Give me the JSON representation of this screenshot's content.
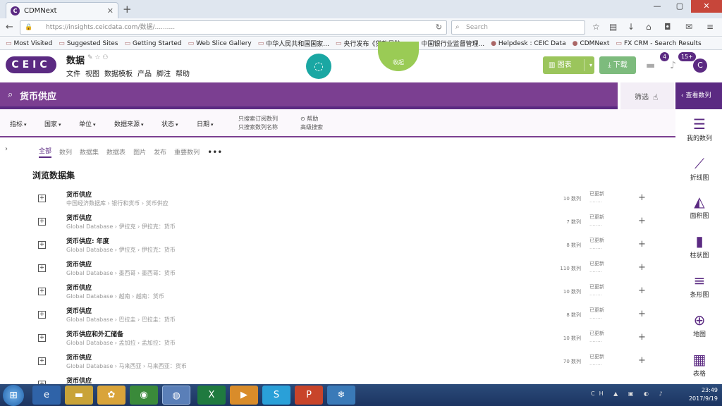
{
  "browser": {
    "tab_title": "CDMNext",
    "tab_close": "✕",
    "new_tab": "+",
    "url": "https://insights.ceicdata.com/数据/..........",
    "search_placeholder": "Search",
    "window_min": "—",
    "window_max": "▢",
    "window_close": "✕",
    "bookmarks": [
      "Most Visited",
      "Suggested Sites",
      "Getting Started",
      "Web Slice Gallery",
      "中华人民共和国国家...",
      "央行发布《贷款风险...",
      "中国银行业监督管理...",
      "Helpdesk : CEIC Data",
      "CDMNext",
      "FX CRM - Search Results"
    ]
  },
  "app": {
    "logo": "CEIC",
    "title": "数据",
    "menu": [
      "文件",
      "视图",
      "数据模板",
      "产品",
      "脚注",
      "帮助"
    ],
    "teal_button_icon": "speech-icon",
    "green_tab_label": "收起",
    "chart_button": "图表",
    "download_button": "下载",
    "chat_badge": "4",
    "notification_badge": "15+",
    "avatar_initial": "C",
    "accent_color": "#5b2a82"
  },
  "search": {
    "query": "货币供应",
    "filter_label": "筛选",
    "view_series_label": "查看数列"
  },
  "filters": {
    "dropdowns": [
      "指标",
      "国家",
      "单位",
      "数据来源",
      "状态",
      "日期"
    ],
    "check_lines": [
      "只搜索订阅数列",
      "只搜索数列名称"
    ],
    "help_lines": [
      "帮助",
      "高级搜索"
    ]
  },
  "tabs": [
    "全部",
    "数列",
    "数据集",
    "数据表",
    "图片",
    "发布",
    "重要数列"
  ],
  "tabs_more": "•••",
  "section_title": "浏览数据集",
  "rows": [
    {
      "name": "货币供应",
      "path": "中国经济数据库 › 银行和货币 › 货币供应",
      "count": "10 数列",
      "status": "已更新",
      "date": "........"
    },
    {
      "name": "货币供应",
      "path": "Global Database › 伊拉克 › 伊拉克：货币",
      "count": "7 数列",
      "status": "已更新",
      "date": "........"
    },
    {
      "name": "货币供应: 年度",
      "path": "Global Database › 伊拉克 › 伊拉克：货币",
      "count": "8 数列",
      "status": "已更新",
      "date": "........"
    },
    {
      "name": "货币供应",
      "path": "Global Database › 墨西哥 › 墨西哥：货币",
      "count": "110 数列",
      "status": "已更新",
      "date": "........"
    },
    {
      "name": "货币供应",
      "path": "Global Database › 越南 › 越南：货币",
      "count": "10 数列",
      "status": "已更新",
      "date": "........"
    },
    {
      "name": "货币供应",
      "path": "Global Database › 巴拉圭 › 巴拉圭：货币",
      "count": "8 数列",
      "status": "已更新",
      "date": "........"
    },
    {
      "name": "货币供应和外汇储备",
      "path": "Global Database › 孟加拉 › 孟加拉：货币",
      "count": "10 数列",
      "status": "已更新",
      "date": "........"
    },
    {
      "name": "货币供应",
      "path": "Global Database › 马来西亚 › 马来西亚：货币",
      "count": "70 数列",
      "status": "已更新",
      "date": "........"
    },
    {
      "name": "货币供应",
      "path": "",
      "count": "",
      "status": "",
      "date": ""
    }
  ],
  "sidebar": [
    {
      "label": "我的数列",
      "icon": "list-icon"
    },
    {
      "label": "折线图",
      "icon": "line-chart-icon"
    },
    {
      "label": "面积图",
      "icon": "area-chart-icon"
    },
    {
      "label": "柱状图",
      "icon": "bar-chart-icon"
    },
    {
      "label": "条形图",
      "icon": "horizontal-bar-chart-icon"
    },
    {
      "label": "地图",
      "icon": "globe-icon"
    },
    {
      "label": "表格",
      "icon": "table-icon"
    }
  ],
  "taskbar": {
    "time": "23:49",
    "date": "2017/9/19",
    "lang": "CH"
  }
}
